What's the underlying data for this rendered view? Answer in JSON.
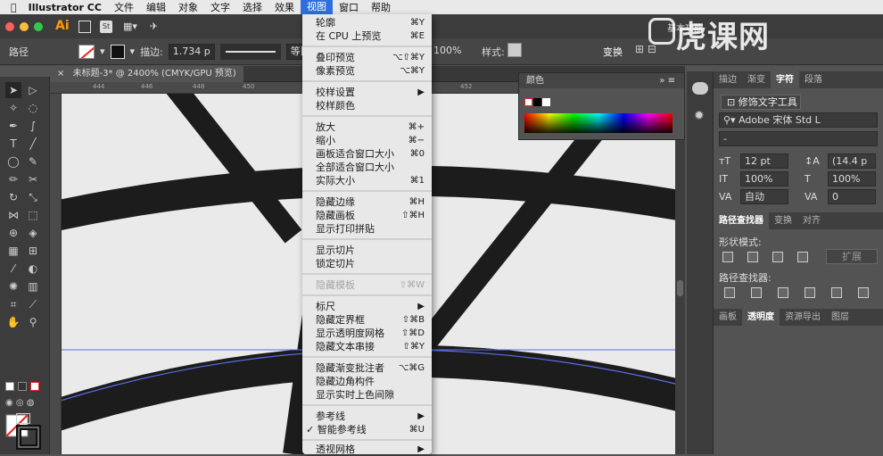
{
  "menubar": {
    "app": "Illustrator CC",
    "items": [
      "文件",
      "编辑",
      "对象",
      "文字",
      "选择",
      "效果",
      "视图",
      "窗口",
      "帮助"
    ],
    "active": "视图"
  },
  "appbar": {
    "logo": "Ai",
    "st": "St",
    "workspace": "基本功能"
  },
  "control": {
    "path_label": "路径",
    "stroke_label": "描边:",
    "stroke_value": "1.734 p",
    "stroke_style": "等比",
    "opacity": "100%",
    "style_label": "样式:",
    "transform": "变换"
  },
  "doc": {
    "tab": "未标题-3* @ 2400% (CMYK/GPU 预览)",
    "ruler": [
      "444",
      "446",
      "448",
      "450",
      "452",
      "454"
    ]
  },
  "menu": {
    "items": [
      {
        "label": "轮廓",
        "shortcut": "⌘Y"
      },
      {
        "label": "在 CPU 上预览",
        "shortcut": "⌘E"
      },
      {
        "label": "叠印预览",
        "shortcut": "⌥⇧⌘Y"
      },
      {
        "label": "像素预览",
        "shortcut": "⌥⌘Y"
      },
      {
        "label": "校样设置",
        "shortcut": "▶"
      },
      {
        "label": "校样颜色",
        "shortcut": ""
      },
      {
        "label": "放大",
        "shortcut": "⌘+"
      },
      {
        "label": "缩小",
        "shortcut": "⌘−"
      },
      {
        "label": "画板适合窗口大小",
        "shortcut": "⌘0"
      },
      {
        "label": "全部适合窗口大小",
        "shortcut": ""
      },
      {
        "label": "实际大小",
        "shortcut": "⌘1"
      },
      {
        "label": "隐藏边缘",
        "shortcut": "⌘H"
      },
      {
        "label": "隐藏画板",
        "shortcut": "⇧⌘H"
      },
      {
        "label": "显示打印拼贴",
        "shortcut": ""
      },
      {
        "label": "显示切片",
        "shortcut": ""
      },
      {
        "label": "锁定切片",
        "shortcut": ""
      },
      {
        "label": "隐藏模板",
        "shortcut": "⇧⌘W"
      },
      {
        "label": "标尺",
        "shortcut": "▶"
      },
      {
        "label": "隐藏定界框",
        "shortcut": "⇧⌘B"
      },
      {
        "label": "显示透明度网格",
        "shortcut": "⇧⌘D"
      },
      {
        "label": "隐藏文本串接",
        "shortcut": "⇧⌘Y"
      },
      {
        "label": "隐藏渐变批注者",
        "shortcut": "⌥⌘G"
      },
      {
        "label": "隐藏边角构件",
        "shortcut": ""
      },
      {
        "label": "显示实时上色间隙",
        "shortcut": ""
      },
      {
        "label": "参考线",
        "shortcut": "▶"
      },
      {
        "label": "✓ 智能参考线",
        "shortcut": "⌘U"
      },
      {
        "label": "透视网格",
        "shortcut": "▶"
      }
    ]
  },
  "color_panel": {
    "title": "颜色"
  },
  "right": {
    "tabs1": [
      "描边",
      "渐变",
      "字符",
      "段落"
    ],
    "touch_type": "修饰文字工具",
    "font": "Adobe 宋体 Std L",
    "font_style": "-",
    "size": "12 pt",
    "leading": "(14.4 p",
    "vscale": "100%",
    "hscale": "100%",
    "tracking_auto": "自动",
    "tracking": "0",
    "tabs2": [
      "路径查找器",
      "变换",
      "对齐"
    ],
    "shape_modes": "形状模式:",
    "expand": "扩展",
    "pathfinder": "路径查找器:",
    "tabs3": [
      "画板",
      "透明度",
      "资源导出",
      "图层"
    ]
  },
  "watermark": "虎课网"
}
